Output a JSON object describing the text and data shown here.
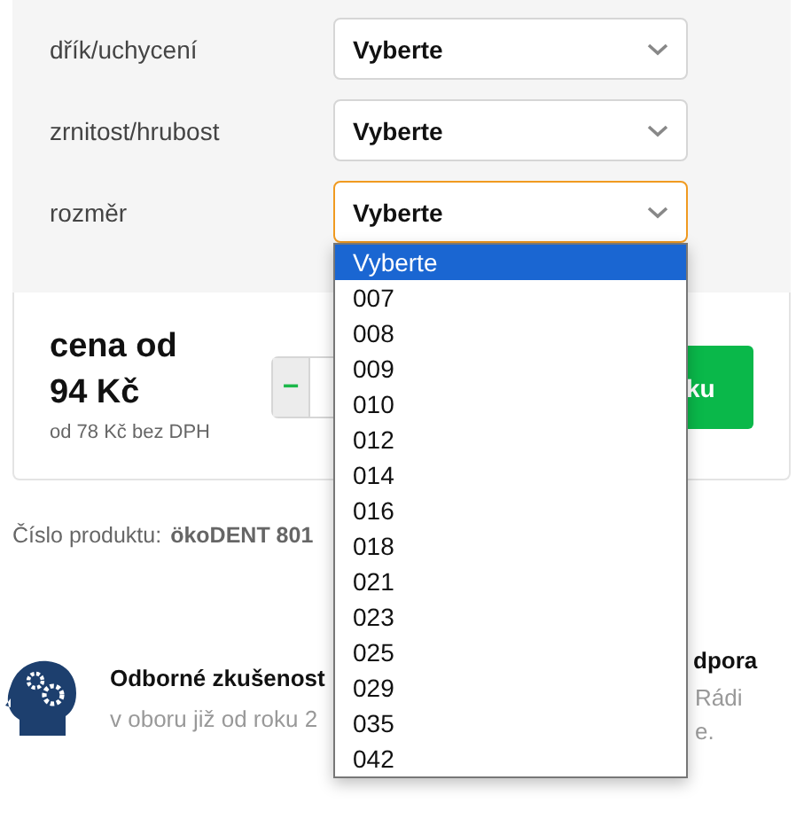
{
  "filters": [
    {
      "label": "dřík/uchycení",
      "value": "Vyberte",
      "focused": false
    },
    {
      "label": "zrnitost/hrubost",
      "value": "Vyberte",
      "focused": false
    },
    {
      "label": "rozměr",
      "value": "Vyberte",
      "focused": true
    }
  ],
  "dropdown": {
    "options": [
      {
        "label": "Vyberte",
        "selected": true
      },
      {
        "label": "007",
        "selected": false
      },
      {
        "label": "008",
        "selected": false
      },
      {
        "label": "009",
        "selected": false
      },
      {
        "label": "010",
        "selected": false
      },
      {
        "label": "012",
        "selected": false
      },
      {
        "label": "014",
        "selected": false
      },
      {
        "label": "016",
        "selected": false
      },
      {
        "label": "018",
        "selected": false
      },
      {
        "label": "021",
        "selected": false
      },
      {
        "label": "023",
        "selected": false
      },
      {
        "label": "025",
        "selected": false
      },
      {
        "label": "029",
        "selected": false
      },
      {
        "label": "035",
        "selected": false
      },
      {
        "label": "042",
        "selected": false
      }
    ]
  },
  "price": {
    "heading": "cena od",
    "amount": "94 Kč",
    "net": "od 78 Kč bez DPH"
  },
  "quantity": {
    "minus": "−"
  },
  "cart_button": {
    "label": "ku"
  },
  "product_number": {
    "label": "Číslo produktu:",
    "value": "ökoDENT 801"
  },
  "features": [
    {
      "title": "Odborné zkušenost",
      "text": "v oboru již od roku 2"
    },
    {
      "title": "dpora",
      "text": "Rádi",
      "text_2": "e."
    }
  ]
}
